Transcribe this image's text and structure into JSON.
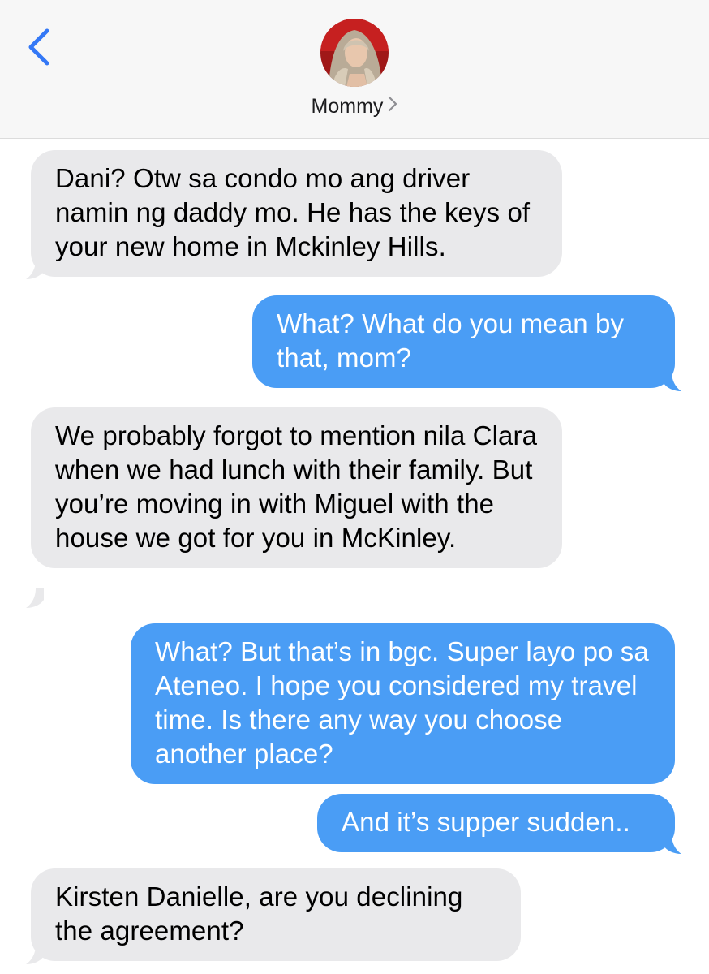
{
  "header": {
    "back_icon": "chevron-left-icon",
    "contact_name": "Mommy",
    "details_icon": "chevron-right-icon",
    "avatar_icon": "contact-photo"
  },
  "colors": {
    "accent": "#3478f6",
    "incoming_bubble": "#e9e9eb",
    "outgoing_bubble": "#4a9df5",
    "header_bg": "#f7f7f7"
  },
  "messages": [
    {
      "direction": "incoming",
      "text": "Dani? Otw sa condo mo ang driver namin ng daddy mo. He has the keys of your new home in Mckinley Hills."
    },
    {
      "direction": "outgoing",
      "text": "What? What do you mean by that, mom?"
    },
    {
      "direction": "incoming",
      "text": "We probably forgot to mention nila Clara when we had lunch with their family. But you’re moving in with Miguel with the house we got for you in McKinley."
    },
    {
      "direction": "outgoing",
      "text": "What? But that’s in bgc. Super layo po sa Ateneo. I hope you considered my travel time. Is there any way you choose another place?"
    },
    {
      "direction": "outgoing",
      "text": "And it’s supper sudden.."
    },
    {
      "direction": "incoming",
      "text": "Kirsten Danielle, are you declining the agreement?"
    }
  ]
}
